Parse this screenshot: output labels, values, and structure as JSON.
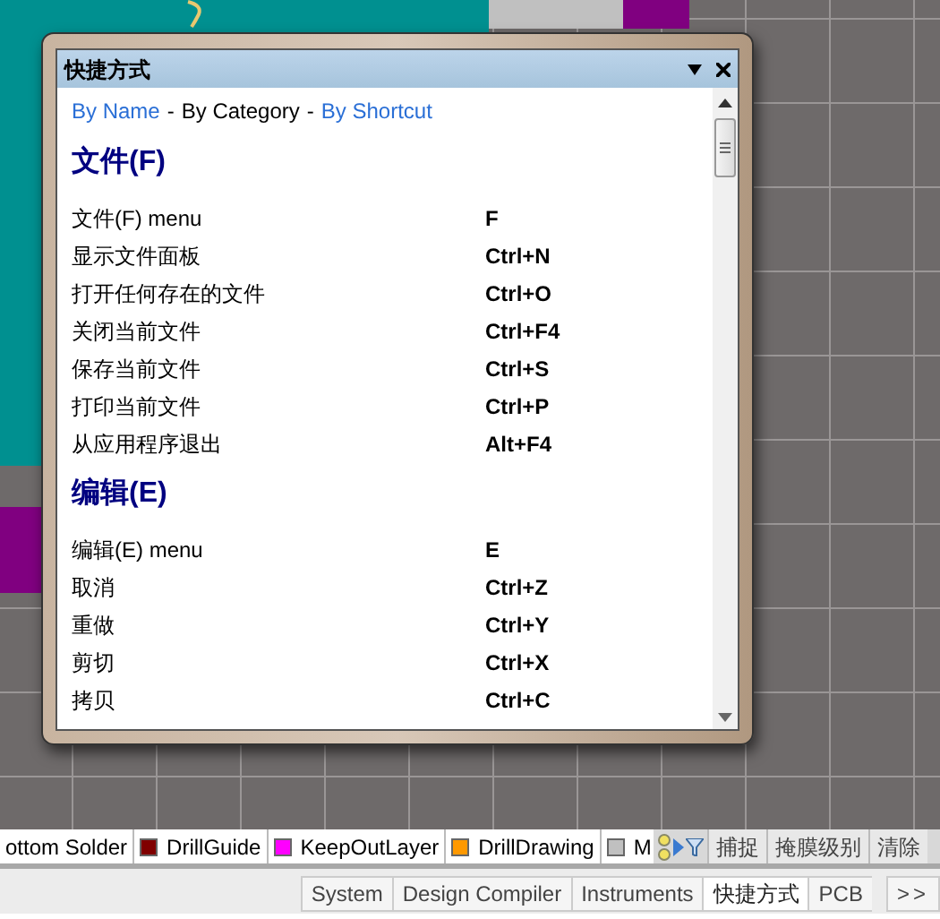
{
  "panel": {
    "title": "快捷方式",
    "views": [
      {
        "label": "By Name",
        "selected": false
      },
      {
        "label": "By Category",
        "selected": true
      },
      {
        "label": "By Shortcut",
        "selected": false
      }
    ],
    "separators": [
      "-",
      "-"
    ],
    "sections": [
      {
        "heading": "文件(F)",
        "rows": [
          {
            "command": "文件(F) menu",
            "shortcut": "F"
          },
          {
            "command": "显示文件面板",
            "shortcut": "Ctrl+N"
          },
          {
            "command": "打开任何存在的文件",
            "shortcut": "Ctrl+O"
          },
          {
            "command": "关闭当前文件",
            "shortcut": "Ctrl+F4"
          },
          {
            "command": "保存当前文件",
            "shortcut": "Ctrl+S"
          },
          {
            "command": "打印当前文件",
            "shortcut": "Ctrl+P"
          },
          {
            "command": "从应用程序退出",
            "shortcut": "Alt+F4"
          }
        ]
      },
      {
        "heading": "编辑(E)",
        "rows": [
          {
            "command": "编辑(E) menu",
            "shortcut": "E"
          },
          {
            "command": "取消",
            "shortcut": "Ctrl+Z"
          },
          {
            "command": "重做",
            "shortcut": "Ctrl+Y"
          },
          {
            "command": "剪切",
            "shortcut": "Ctrl+X"
          },
          {
            "command": "拷贝",
            "shortcut": "Ctrl+C"
          }
        ]
      }
    ]
  },
  "layer_tabs": [
    {
      "label": "ottom Solder"
    },
    {
      "label": "DrillGuide",
      "color": "#800000"
    },
    {
      "label": "KeepOutLayer",
      "color": "#ff00ff"
    },
    {
      "label": "DrillDrawing",
      "color": "#ff9900"
    },
    {
      "label": "M",
      "color": "#c0c0c0"
    }
  ],
  "layer_buttons": [
    "捕捉",
    "掩膜级别",
    "清除"
  ],
  "panel_tabs": [
    {
      "label": "System",
      "selected": false
    },
    {
      "label": "Design Compiler",
      "selected": false
    },
    {
      "label": "Instruments",
      "selected": false
    },
    {
      "label": "快捷方式",
      "selected": true
    },
    {
      "label": "PCB",
      "selected": false
    }
  ],
  "more": ">>"
}
